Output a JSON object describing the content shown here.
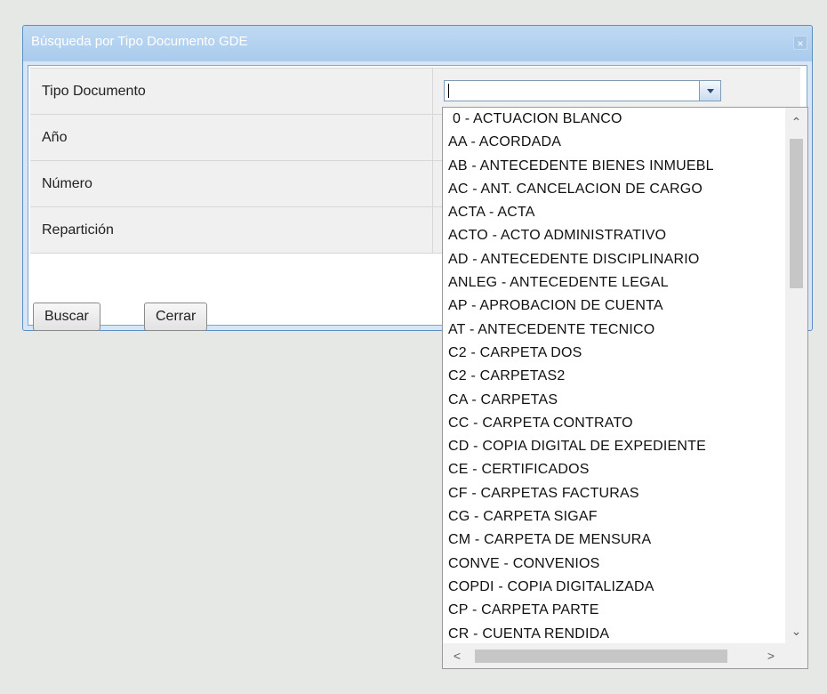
{
  "dialog": {
    "title": "Búsqueda por Tipo Documento GDE",
    "close_icon": "close-icon",
    "close_glyph": "×"
  },
  "form": {
    "rows": [
      {
        "label": "Tipo Documento"
      },
      {
        "label": "Año"
      },
      {
        "label": "Número"
      },
      {
        "label": "Repartición"
      }
    ],
    "tipo_documento_value": ""
  },
  "buttons": {
    "search_label": "Buscar",
    "close_label": "Cerrar"
  },
  "dropdown": {
    "items": [
      "0 - ACTUACION BLANCO",
      "AA - ACORDADA",
      "AB - ANTECEDENTE BIENES INMUEBL",
      "AC - ANT. CANCELACION DE CARGO",
      "ACTA - ACTA",
      "ACTO - ACTO ADMINISTRATIVO",
      "AD - ANTECEDENTE DISCIPLINARIO",
      "ANLEG - ANTECEDENTE LEGAL",
      "AP - APROBACION DE CUENTA",
      "AT - ANTECEDENTE TECNICO",
      "C2 - CARPETA DOS",
      "C2 - CARPETAS2",
      "CA - CARPETAS",
      "CC - CARPETA CONTRATO",
      "CD - COPIA DIGITAL DE EXPEDIENTE",
      "CE - CERTIFICADOS",
      "CF - CARPETAS FACTURAS",
      "CG - CARPETA SIGAF",
      "CM - CARPETA DE MENSURA",
      "CONVE - CONVENIOS",
      "COPDI - COPIA DIGITALIZADA",
      "CP - CARPETA PARTE",
      "CR - CUENTA RENDIDA"
    ],
    "scroll_up_glyph": "⌃",
    "scroll_down_glyph": "⌄",
    "scroll_left_glyph": "<",
    "scroll_right_glyph": ">"
  }
}
